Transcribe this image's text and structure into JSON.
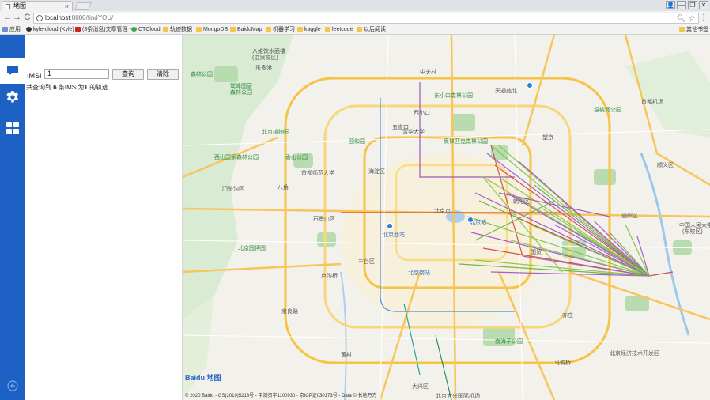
{
  "browser": {
    "tab_title": "地图",
    "tab_close": "×",
    "url_host": "localhost",
    "url_path": ":8080/findYOU/",
    "win_buttons": [
      "👤",
      "—",
      "❐",
      "✕"
    ],
    "nav": {
      "back": "←",
      "forward": "→",
      "reload": "C"
    },
    "bookmarks": [
      "应用",
      "kyle-cloud (Kyle)",
      "(3条消息)文章管理 -",
      "CTCloud",
      "轨迹数据",
      "MongoDB",
      "BaiduMap",
      "机器学习",
      "kaggle",
      "leetcode",
      "以后阅读",
      "其他书签"
    ]
  },
  "panel": {
    "imsi_label": "IMSI",
    "imsi_value": "1",
    "query_button": "查询",
    "clear_button": "清除",
    "result_prefix": "共查询到",
    "result_count": "6",
    "result_mid": "条IMSI为",
    "result_imsi": "1",
    "result_suffix": "的轨迹"
  },
  "map": {
    "logo_bai": "Bai",
    "logo_du": "du",
    "logo_suffix": "地图",
    "copyright": "© 2020 Baidu - GS(2019)5218号 - 甲测资字1100930 - 京ICP证030173号 - Data © 长地万方",
    "labels": [
      {
        "text": "八维饮水面楼",
        "cls": ""
      },
      {
        "text": "(溢泉校区)",
        "cls": ""
      },
      {
        "text": "乐多港",
        "cls": ""
      },
      {
        "text": "森林公园",
        "cls": "green"
      },
      {
        "text": "鹫峰国家",
        "cls": "green"
      },
      {
        "text": "森林公园",
        "cls": "green"
      },
      {
        "text": "中关村",
        "cls": ""
      },
      {
        "text": "东小口森林公园",
        "cls": "green"
      },
      {
        "text": "西小口",
        "cls": ""
      },
      {
        "text": "天通苑北",
        "cls": ""
      },
      {
        "text": "北京植物园",
        "cls": "green"
      },
      {
        "text": "五道口",
        "cls": ""
      },
      {
        "text": "颐和园",
        "cls": "green"
      },
      {
        "text": "清华大学",
        "cls": ""
      },
      {
        "text": "奥林匹克森林公园",
        "cls": "green"
      },
      {
        "text": "海淀区",
        "cls": ""
      },
      {
        "text": "香山公园",
        "cls": "green"
      },
      {
        "text": "北京市",
        "cls": ""
      },
      {
        "text": "石景山区",
        "cls": ""
      },
      {
        "text": "北京西站",
        "cls": "blue"
      },
      {
        "text": "北京站",
        "cls": "blue"
      },
      {
        "text": "丰台区",
        "cls": ""
      },
      {
        "text": "北京南站",
        "cls": "blue"
      },
      {
        "text": "朝阳区",
        "cls": ""
      },
      {
        "text": "通州区",
        "cls": ""
      },
      {
        "text": "大兴区",
        "cls": ""
      },
      {
        "text": "顺义区",
        "cls": ""
      },
      {
        "text": "温榆河公园",
        "cls": "green"
      },
      {
        "text": "望京",
        "cls": ""
      },
      {
        "text": "首都机场",
        "cls": ""
      },
      {
        "text": "国贸",
        "cls": ""
      },
      {
        "text": "亦庄",
        "cls": ""
      },
      {
        "text": "北京经济技术开发区",
        "cls": ""
      },
      {
        "text": "黄村",
        "cls": ""
      },
      {
        "text": "马驹桥",
        "cls": ""
      },
      {
        "text": "中国人民大学",
        "cls": ""
      },
      {
        "text": "(东校区)",
        "cls": ""
      },
      {
        "text": "首都师范大学",
        "cls": ""
      },
      {
        "text": "卢沟桥",
        "cls": ""
      },
      {
        "text": "北京园博园",
        "cls": "green"
      },
      {
        "text": "南海子公园",
        "cls": "green"
      },
      {
        "text": "京良路",
        "cls": ""
      },
      {
        "text": "北京大兴国际机场",
        "cls": ""
      },
      {
        "text": "八角",
        "cls": ""
      },
      {
        "text": "门头沟区",
        "cls": ""
      },
      {
        "text": "西山国家森林公园",
        "cls": "green"
      }
    ]
  }
}
